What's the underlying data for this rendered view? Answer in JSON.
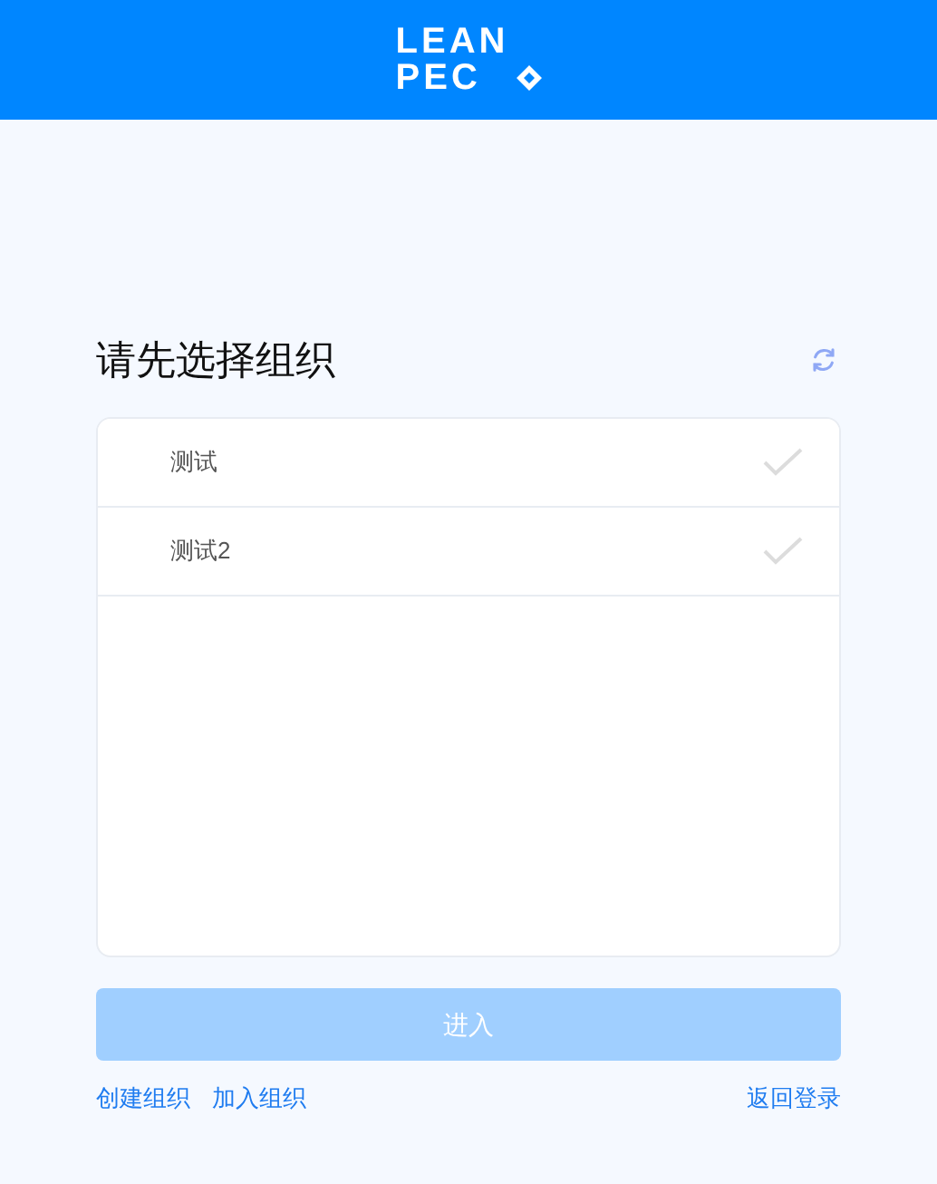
{
  "header": {
    "logo_lines": [
      "LEAN",
      "PEC"
    ]
  },
  "title": "请先选择组织",
  "organizations": [
    {
      "name": "测试",
      "selected": false
    },
    {
      "name": "测试2",
      "selected": false
    }
  ],
  "enter_button": {
    "label": "进入",
    "disabled": true
  },
  "links": {
    "left": [
      "创建组织",
      "加入组织"
    ],
    "right": "返回登录"
  }
}
